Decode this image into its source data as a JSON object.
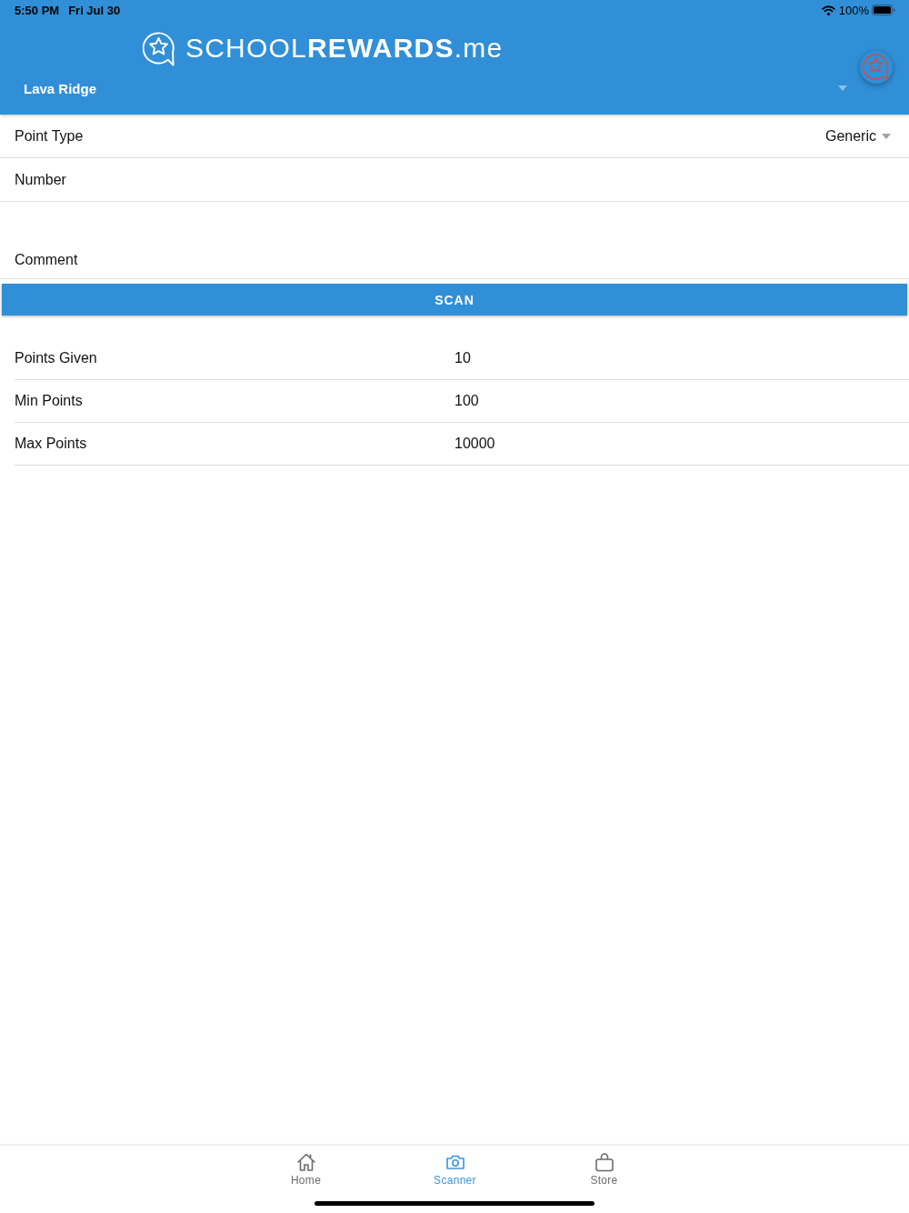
{
  "status_bar": {
    "time": "5:50 PM",
    "date": "Fri Jul 30",
    "battery": "100%"
  },
  "header": {
    "logo": "SCHOOL**REWARDS**.me",
    "school_picker": {
      "value": "Lava Ridge"
    }
  },
  "form": {
    "point_type": {
      "label": "Point Type",
      "value": "Generic"
    },
    "number": {
      "placeholder": "Number"
    },
    "comment": {
      "placeholder": "Comment"
    },
    "scan_button": "SCAN"
  },
  "stats": [
    {
      "label": "Points Given",
      "value": "10"
    },
    {
      "label": "Min Points",
      "value": "100"
    },
    {
      "label": "Max Points",
      "value": "10000"
    }
  ],
  "tab_bar": [
    {
      "label": "Home",
      "selected": false
    },
    {
      "label": "Scanner",
      "selected": true
    },
    {
      "label": "Store",
      "selected": false
    }
  ]
}
